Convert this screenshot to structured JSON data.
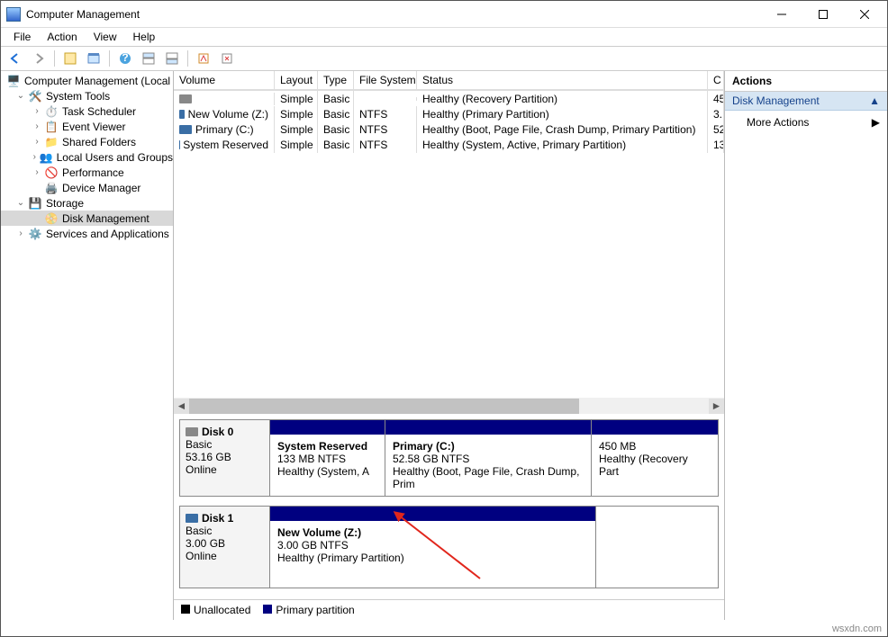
{
  "window": {
    "title": "Computer Management"
  },
  "menu": {
    "file": "File",
    "action": "Action",
    "view": "View",
    "help": "Help"
  },
  "tree": {
    "root": "Computer Management (Local",
    "system_tools": "System Tools",
    "task_scheduler": "Task Scheduler",
    "event_viewer": "Event Viewer",
    "shared_folders": "Shared Folders",
    "local_users": "Local Users and Groups",
    "performance": "Performance",
    "device_manager": "Device Manager",
    "storage": "Storage",
    "disk_mgmt": "Disk Management",
    "services": "Services and Applications"
  },
  "vol_headers": {
    "volume": "Volume",
    "layout": "Layout",
    "type": "Type",
    "fs": "File System",
    "status": "Status",
    "cap": "C"
  },
  "volumes": [
    {
      "name": "",
      "layout": "Simple",
      "type": "Basic",
      "fs": "",
      "status": "Healthy (Recovery Partition)",
      "cap": "45"
    },
    {
      "name": "New Volume (Z:)",
      "layout": "Simple",
      "type": "Basic",
      "fs": "NTFS",
      "status": "Healthy (Primary Partition)",
      "cap": "3."
    },
    {
      "name": "Primary (C:)",
      "layout": "Simple",
      "type": "Basic",
      "fs": "NTFS",
      "status": "Healthy (Boot, Page File, Crash Dump, Primary Partition)",
      "cap": "52"
    },
    {
      "name": "System Reserved",
      "layout": "Simple",
      "type": "Basic",
      "fs": "NTFS",
      "status": "Healthy (System, Active, Primary Partition)",
      "cap": "13"
    }
  ],
  "disk0": {
    "name": "Disk 0",
    "type": "Basic",
    "size": "53.16 GB",
    "state": "Online",
    "p0": {
      "name": "System Reserved",
      "l2": "133 MB NTFS",
      "l3": "Healthy (System, A"
    },
    "p1": {
      "name": "Primary  (C:)",
      "l2": "52.58 GB NTFS",
      "l3": "Healthy (Boot, Page File, Crash Dump, Prim"
    },
    "p2": {
      "name": "",
      "l2": "450 MB",
      "l3": "Healthy (Recovery Part"
    }
  },
  "disk1": {
    "name": "Disk 1",
    "type": "Basic",
    "size": "3.00 GB",
    "state": "Online",
    "p0": {
      "name": "New Volume  (Z:)",
      "l2": "3.00 GB NTFS",
      "l3": "Healthy (Primary Partition)"
    }
  },
  "legend": {
    "unalloc": "Unallocated",
    "primary": "Primary partition"
  },
  "actions": {
    "title": "Actions",
    "section": "Disk Management",
    "more": "More Actions"
  },
  "watermark": "wsxdn.com"
}
